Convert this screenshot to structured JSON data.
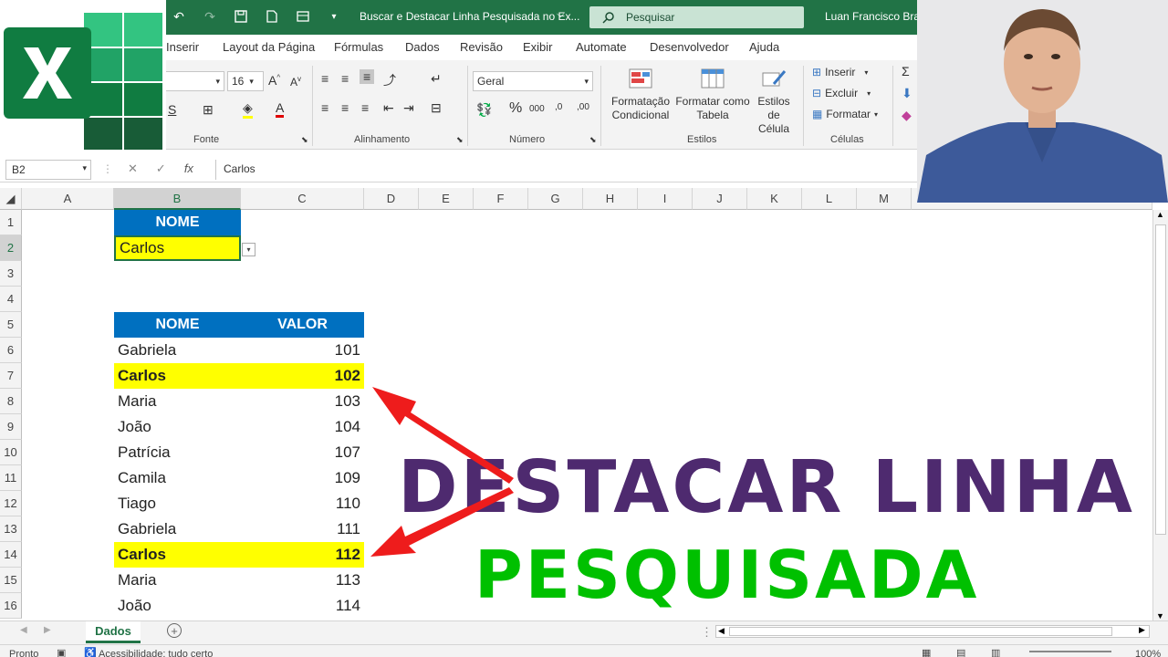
{
  "title_bar": {
    "doc_title": "Buscar e Destacar Linha Pesquisada no Ex...",
    "search_placeholder": "Pesquisar",
    "user": "Luan Francisco Braga"
  },
  "tabs": [
    "Inserir",
    "Layout da Página",
    "Fórmulas",
    "Dados",
    "Revisão",
    "Exibir",
    "Automate",
    "Desenvolvedor",
    "Ajuda"
  ],
  "ribbon": {
    "font_size": "16",
    "number_format": "Geral",
    "groups": {
      "font": "Fonte",
      "alignment": "Alinhamento",
      "number": "Número",
      "styles": "Estilos",
      "cells": "Células"
    },
    "styles_buttons": {
      "cond_format_1": "Formatação",
      "cond_format_2": "Condicional",
      "table_format_1": "Formatar como",
      "table_format_2": "Tabela",
      "cell_styles_1": "Estilos de",
      "cell_styles_2": "Célula"
    },
    "cells_buttons": {
      "insert": "Inserir",
      "delete": "Excluir",
      "format": "Formatar"
    }
  },
  "formula_bar": {
    "name_box": "B2",
    "formula": "Carlos"
  },
  "columns": [
    "A",
    "B",
    "C",
    "D",
    "E",
    "F",
    "G",
    "H",
    "I",
    "J",
    "K",
    "L",
    "M"
  ],
  "rows": [
    "1",
    "2",
    "3",
    "4",
    "5",
    "6",
    "7",
    "8",
    "9",
    "10",
    "11",
    "12",
    "13",
    "14",
    "15",
    "16"
  ],
  "search": {
    "header": "NOME",
    "value": "Carlos"
  },
  "table": {
    "headers": {
      "name": "NOME",
      "value": "VALOR"
    },
    "rows": [
      {
        "name": "Gabriela",
        "value": "101",
        "highlight": false
      },
      {
        "name": "Carlos",
        "value": "102",
        "highlight": true
      },
      {
        "name": "Maria",
        "value": "103",
        "highlight": false
      },
      {
        "name": "João",
        "value": "104",
        "highlight": false
      },
      {
        "name": "Patrícia",
        "value": "107",
        "highlight": false
      },
      {
        "name": "Camila",
        "value": "109",
        "highlight": false
      },
      {
        "name": "Tiago",
        "value": "110",
        "highlight": false
      },
      {
        "name": "Gabriela",
        "value": "111",
        "highlight": false
      },
      {
        "name": "Carlos",
        "value": "112",
        "highlight": true
      },
      {
        "name": "Maria",
        "value": "113",
        "highlight": false
      },
      {
        "name": "João",
        "value": "114",
        "highlight": false
      }
    ]
  },
  "headline": {
    "line1": "DESTACAR LINHA",
    "line2": "PESQUISADA"
  },
  "sheet_tab": "Dados",
  "status": {
    "ready": "Pronto",
    "accessibility": "Acessibilidade: tudo certo",
    "zoom": "100%"
  },
  "colors": {
    "excel_green": "#217346",
    "header_blue": "#0070c0",
    "highlight_yellow": "#ffff00",
    "headline_purple": "#4e2a6f",
    "headline_green": "#00c000",
    "arrow_red": "#ee1c1c"
  }
}
